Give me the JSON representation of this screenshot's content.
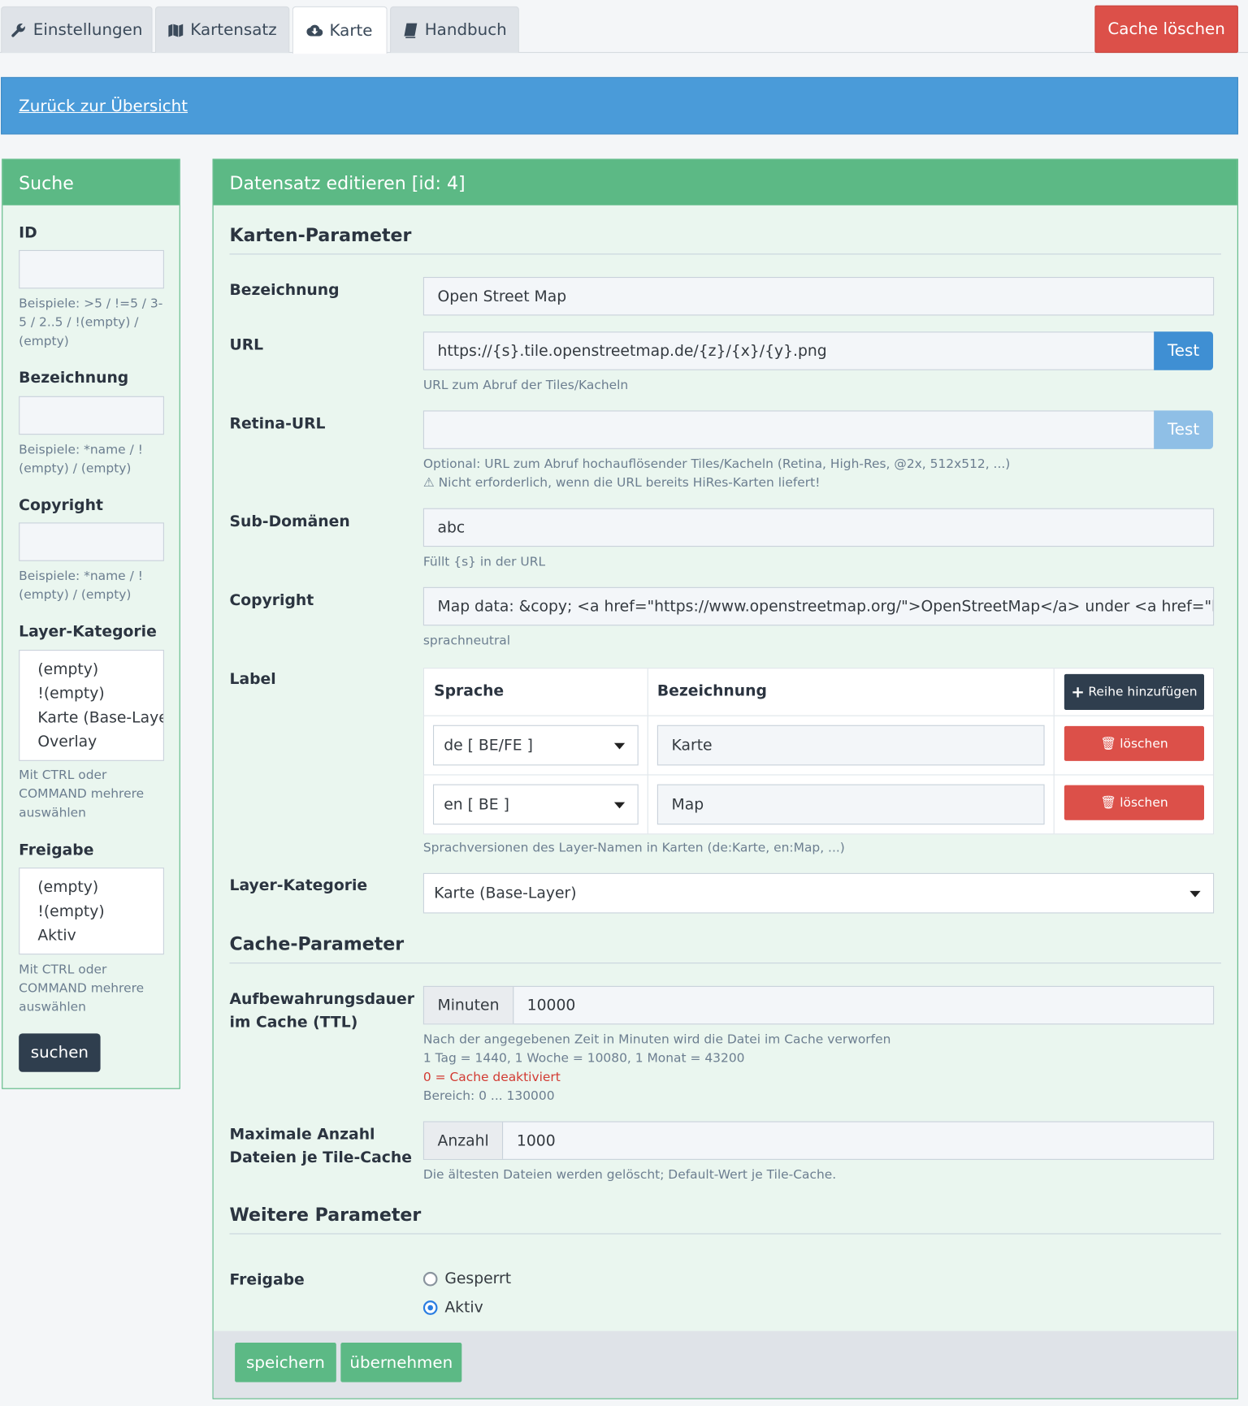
{
  "tabs": [
    {
      "label": "Einstellungen",
      "icon": "wrench-icon"
    },
    {
      "label": "Kartensatz",
      "icon": "map-icon"
    },
    {
      "label": "Karte",
      "icon": "cloud-download-icon"
    },
    {
      "label": "Handbuch",
      "icon": "book-icon"
    }
  ],
  "cache_button": "Cache löschen",
  "back_link": "Zurück zur Übersicht",
  "search": {
    "title": "Suche",
    "id_label": "ID",
    "id_help": "Beispiele: >5 / !=5 / 3-5 / 2..5 / !(empty) / (empty)",
    "name_label": "Bezeichnung",
    "name_help": "Beispiele: *name / !(empty) / (empty)",
    "copyright_label": "Copyright",
    "copyright_help": "Beispiele: *name / !(empty) / (empty)",
    "layer_label": "Layer-Kategorie",
    "layer_options": [
      "(empty)",
      "!(empty)",
      "Karte (Base-Layer)",
      "Overlay"
    ],
    "layer_help": "Mit CTRL oder COMMAND mehrere auswählen",
    "release_label": "Freigabe",
    "release_options": [
      "(empty)",
      "!(empty)",
      "Aktiv"
    ],
    "release_help": "Mit CTRL oder COMMAND mehrere auswählen",
    "submit": "suchen"
  },
  "form": {
    "title": "Datensatz editieren [id: 4]",
    "section_map": "Karten-Parameter",
    "name_label": "Bezeichnung",
    "name_value": "Open Street Map",
    "url_label": "URL",
    "url_value": "https://{s}.tile.openstreetmap.de/{z}/{x}/{y}.png",
    "url_help": "URL zum Abruf der Tiles/Kacheln",
    "test_label": "Test",
    "retina_label": "Retina-URL",
    "retina_value": "",
    "retina_help1": "Optional: URL zum Abruf hochauflösender Tiles/Kacheln (Retina, High-Res, @2x, 512x512, ...)",
    "retina_help2": "⚠ Nicht erforderlich, wenn die URL bereits HiRes-Karten liefert!",
    "sub_label": "Sub-Domänen",
    "sub_value": "abc",
    "sub_help": "Füllt {s} in der URL",
    "copyright_label": "Copyright",
    "copyright_value": "Map data: &copy; <a href=\"https://www.openstreetmap.org/\">OpenStreetMap</a> under <a href=\"https://opendatacommons.org/licenses/odbl/\">ODbL</a>",
    "copyright_help": "sprachneutral",
    "label_label": "Label",
    "label_table": {
      "col_lang": "Sprache",
      "col_name": "Bezeichnung",
      "add_row": "Reihe hinzufügen",
      "delete": "löschen",
      "rows": [
        {
          "lang": "de [ BE/FE ]",
          "name": "Karte"
        },
        {
          "lang": "en [ BE ]",
          "name": "Map"
        }
      ]
    },
    "label_help": "Sprachversionen des Layer-Namen in Karten (de:Karte, en:Map, ...)",
    "layer_label": "Layer-Kategorie",
    "layer_value": "Karte (Base-Layer)",
    "section_cache": "Cache-Parameter",
    "ttl_label_1": "Aufbewahrungsdauer",
    "ttl_label_2": "im Cache (TTL)",
    "ttl_addon": "Minuten",
    "ttl_value": "10000",
    "ttl_help1": "Nach der angegebenen Zeit in Minuten wird die Datei im Cache verworfen",
    "ttl_help2": "1 Tag = 1440, 1 Woche = 10080, 1 Monat = 43200",
    "ttl_help3": "0 = Cache deaktiviert",
    "ttl_help4": "Bereich: 0 ... 130000",
    "max_label_1": "Maximale Anzahl",
    "max_label_2": "Dateien je Tile-Cache",
    "max_addon": "Anzahl",
    "max_value": "1000",
    "max_help": "Die ältesten Dateien werden gelöscht; Default-Wert je Tile-Cache.",
    "section_more": "Weitere Parameter",
    "release_label": "Freigabe",
    "radio_locked": "Gesperrt",
    "radio_active": "Aktiv",
    "save": "speichern",
    "apply": "übernehmen"
  },
  "colors": {
    "green": "#5cb985",
    "blue": "#4a9bd9",
    "red": "#dc5049",
    "dark": "#2f3e4e"
  }
}
